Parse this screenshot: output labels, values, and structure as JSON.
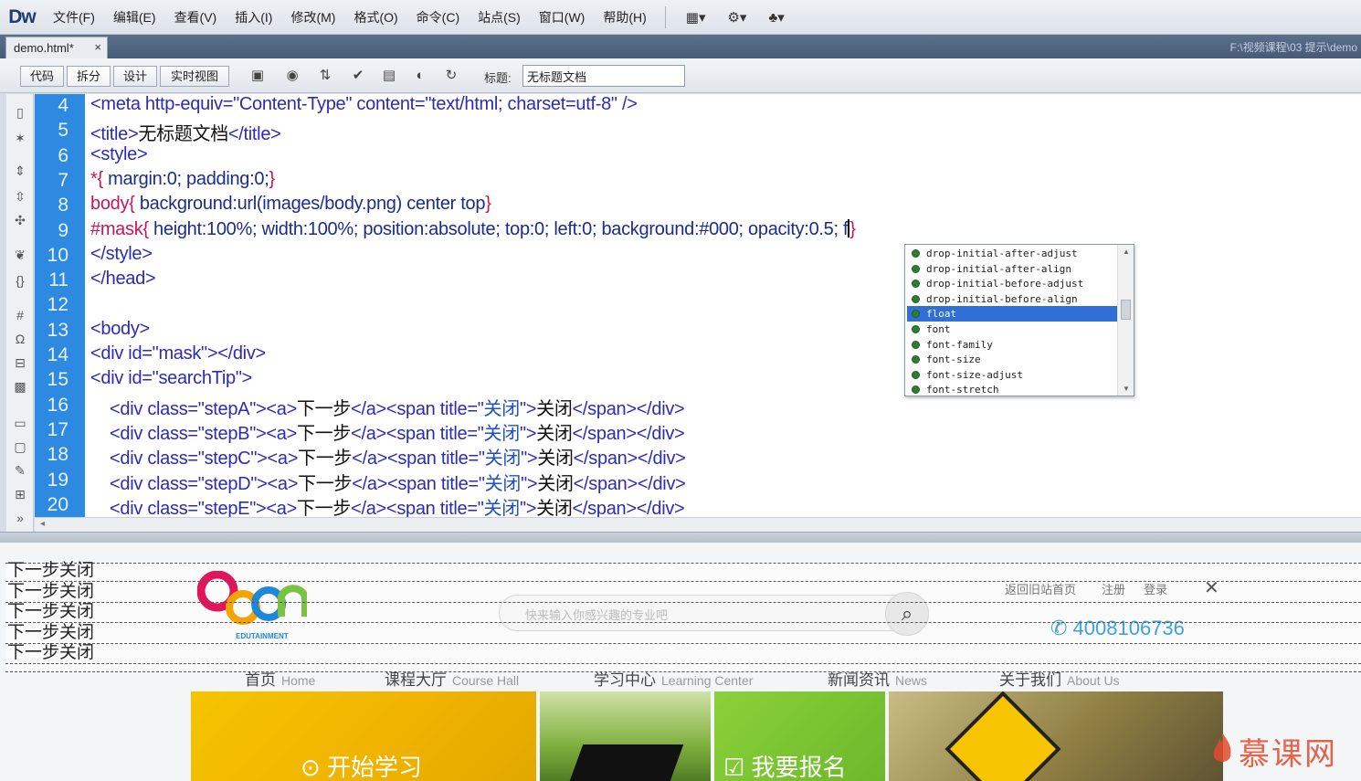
{
  "app": {
    "logo": "Dw"
  },
  "menu": {
    "items": [
      "文件(F)",
      "编辑(E)",
      "查看(V)",
      "插入(I)",
      "修改(M)",
      "格式(O)",
      "命令(C)",
      "站点(S)",
      "窗口(W)",
      "帮助(H)"
    ],
    "icons": [
      "layout-icon",
      "gear-icon",
      "site-icon"
    ]
  },
  "tabs": {
    "document": "demo.html*",
    "close": "×",
    "path": "F:\\视频课程\\03 提示\\demo"
  },
  "doc_toolbar": {
    "views": [
      "代码",
      "拆分",
      "设计",
      "实时视图"
    ],
    "active_view": "拆分",
    "title_label": "标题:",
    "title_value": "无标题文档"
  },
  "code": {
    "line_numbers": [
      "4",
      "5",
      "6",
      "7",
      "8",
      "9",
      "10",
      "11",
      "12",
      "13",
      "14",
      "15",
      "16",
      "17",
      "18",
      "19",
      "20"
    ],
    "lines": [
      {
        "segments": [
          {
            "cls": "tag",
            "text": "<meta http-equiv=\"Content-Type\" content=\"text/html; charset=utf-8\" />"
          }
        ]
      },
      {
        "segments": [
          {
            "cls": "tag",
            "text": "<title>"
          },
          {
            "cls": "txt",
            "text": "无标题文档"
          },
          {
            "cls": "tag",
            "text": "</title>"
          }
        ]
      },
      {
        "segments": [
          {
            "cls": "tag",
            "text": "<style>"
          }
        ]
      },
      {
        "segments": [
          {
            "cls": "sel",
            "text": "*{ "
          },
          {
            "cls": "prop",
            "text": "margin:0; padding:0;"
          },
          {
            "cls": "sel",
            "text": "}"
          }
        ]
      },
      {
        "segments": [
          {
            "cls": "sel",
            "text": "body{ "
          },
          {
            "cls": "prop",
            "text": "background:url(images/body.png) center top"
          },
          {
            "cls": "sel",
            "text": "}"
          }
        ]
      },
      {
        "segments": [
          {
            "cls": "sel",
            "text": "#mask{ "
          },
          {
            "cls": "prop",
            "text": "height:100%; width:100%; position:absolute; top:0; left:0; background:#000; opacity:0.5; f"
          },
          {
            "cls": "caret",
            "text": ""
          },
          {
            "cls": "sel",
            "text": "}"
          }
        ]
      },
      {
        "segments": [
          {
            "cls": "tag",
            "text": "</style>"
          }
        ]
      },
      {
        "segments": [
          {
            "cls": "tag",
            "text": "</head>"
          }
        ]
      },
      {
        "segments": []
      },
      {
        "segments": [
          {
            "cls": "tag",
            "text": "<body>"
          }
        ]
      },
      {
        "segments": [
          {
            "cls": "tag",
            "text": "<div id=\"mask\"></div>"
          }
        ]
      },
      {
        "segments": [
          {
            "cls": "tag",
            "text": "<div id=\"searchTip\">"
          }
        ]
      },
      {
        "segments": [
          {
            "cls": "tag",
            "text": "    <div class=\"stepA\"><a>"
          },
          {
            "cls": "txt",
            "text": "下一步"
          },
          {
            "cls": "tag",
            "text": "</a><span title=\""
          },
          {
            "cls": "val",
            "text": "关闭"
          },
          {
            "cls": "tag",
            "text": "\">"
          },
          {
            "cls": "txt",
            "text": "关闭"
          },
          {
            "cls": "tag",
            "text": "</span></div>"
          }
        ]
      },
      {
        "segments": [
          {
            "cls": "tag",
            "text": "    <div class=\"stepB\"><a>"
          },
          {
            "cls": "txt",
            "text": "下一步"
          },
          {
            "cls": "tag",
            "text": "</a><span title=\""
          },
          {
            "cls": "val",
            "text": "关闭"
          },
          {
            "cls": "tag",
            "text": "\">"
          },
          {
            "cls": "txt",
            "text": "关闭"
          },
          {
            "cls": "tag",
            "text": "</span></div>"
          }
        ]
      },
      {
        "segments": [
          {
            "cls": "tag",
            "text": "    <div class=\"stepC\"><a>"
          },
          {
            "cls": "txt",
            "text": "下一步"
          },
          {
            "cls": "tag",
            "text": "</a><span title=\""
          },
          {
            "cls": "val",
            "text": "关闭"
          },
          {
            "cls": "tag",
            "text": "\">"
          },
          {
            "cls": "txt",
            "text": "关闭"
          },
          {
            "cls": "tag",
            "text": "</span></div>"
          }
        ]
      },
      {
        "segments": [
          {
            "cls": "tag",
            "text": "    <div class=\"stepD\"><a>"
          },
          {
            "cls": "txt",
            "text": "下一步"
          },
          {
            "cls": "tag",
            "text": "</a><span title=\""
          },
          {
            "cls": "val",
            "text": "关闭"
          },
          {
            "cls": "tag",
            "text": "\">"
          },
          {
            "cls": "txt",
            "text": "关闭"
          },
          {
            "cls": "tag",
            "text": "</span></div>"
          }
        ]
      },
      {
        "segments": [
          {
            "cls": "tag",
            "text": "    <div class=\"stepE\"><a>"
          },
          {
            "cls": "txt",
            "text": "下一步"
          },
          {
            "cls": "tag",
            "text": "</a><span title=\""
          },
          {
            "cls": "val",
            "text": "关闭"
          },
          {
            "cls": "tag",
            "text": "\">"
          },
          {
            "cls": "txt",
            "text": "关闭"
          },
          {
            "cls": "tag",
            "text": "</span></div>"
          }
        ]
      }
    ]
  },
  "code_hint": {
    "items": [
      "drop-initial-after-adjust",
      "drop-initial-after-align",
      "drop-initial-before-adjust",
      "drop-initial-before-align",
      "float",
      "font",
      "font-family",
      "font-size",
      "font-size-adjust",
      "font-stretch"
    ],
    "selected": "float"
  },
  "design_view": {
    "steps": [
      "下一步关闭",
      "下一步关闭",
      "下一步关闭",
      "下一步关闭",
      "下一步关闭"
    ],
    "search_placeholder": "快来输入你感兴趣的专业吧",
    "top_links": [
      "返回旧站首页",
      "注册",
      "登录"
    ],
    "phone": "4008106736",
    "nav": [
      {
        "cn": "首页",
        "en": "Home"
      },
      {
        "cn": "课程大厅",
        "en": "Course Hall"
      },
      {
        "cn": "学习中心",
        "en": "Learning Center"
      },
      {
        "cn": "新闻资讯",
        "en": "News"
      },
      {
        "cn": "关于我们",
        "en": "About Us"
      }
    ],
    "banner_labels": [
      "开始学习",
      "我要报名"
    ],
    "logo_subtext": "EDUTAINMENT"
  },
  "watermark": "慕课网",
  "colors": {
    "gutter": "#2d8ae0",
    "tag": "#2b2bb5",
    "selector": "#c2185b",
    "hint_selected": "#2f6fd6",
    "phone": "#3fa0e0"
  }
}
